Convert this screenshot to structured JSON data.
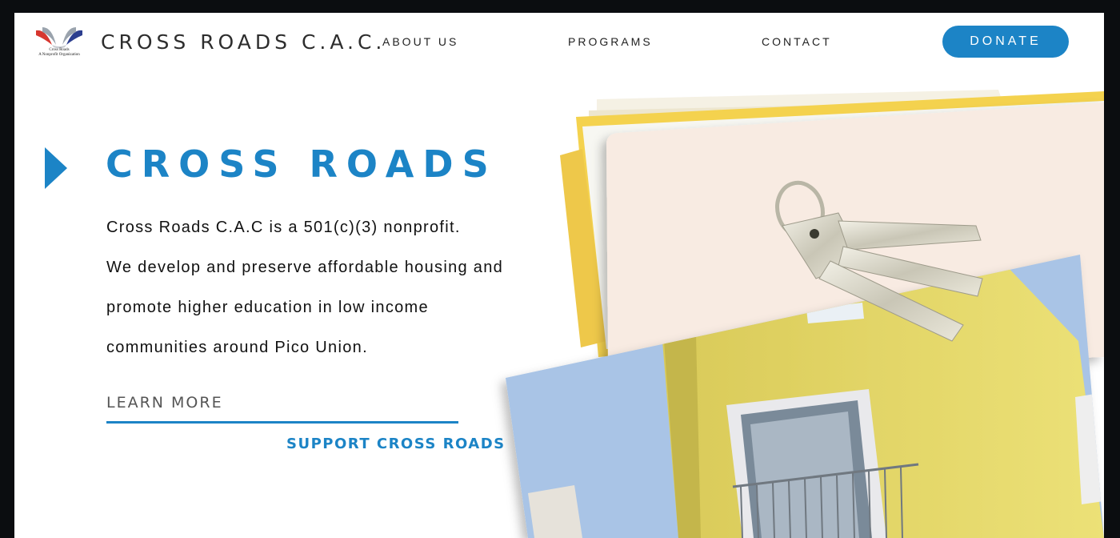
{
  "header": {
    "logo_caption_line1": "Cross Roads",
    "logo_caption_line2": "A Nonprofit Organization",
    "brand": "CROSS ROADS C.A.C.",
    "nav": [
      {
        "label": "ABOUT US"
      },
      {
        "label": "PROGRAMS"
      },
      {
        "label": "CONTACT"
      }
    ],
    "donate_label": "DONATE"
  },
  "hero": {
    "title": "CROSS ROADS",
    "lines": [
      "Cross Roads C.A.C is a 501(c)(3) nonprofit.",
      "We develop and preserve affordable housing and",
      "promote higher education in low income",
      "communities around Pico Union."
    ],
    "learn_more": "LEARN MORE",
    "support": "SUPPORT CROSS ROADS"
  },
  "colors": {
    "accent": "#1c84c6",
    "text": "#111111",
    "frame": "#0b0d10",
    "house_wall": "#e8dc6e",
    "sky": "#a9c4e6",
    "card": "#f8ebe2",
    "folder": "#f4d24e"
  },
  "icons": {
    "logo": "book-bird-logo",
    "hero_marker": "play-arrow-icon"
  }
}
